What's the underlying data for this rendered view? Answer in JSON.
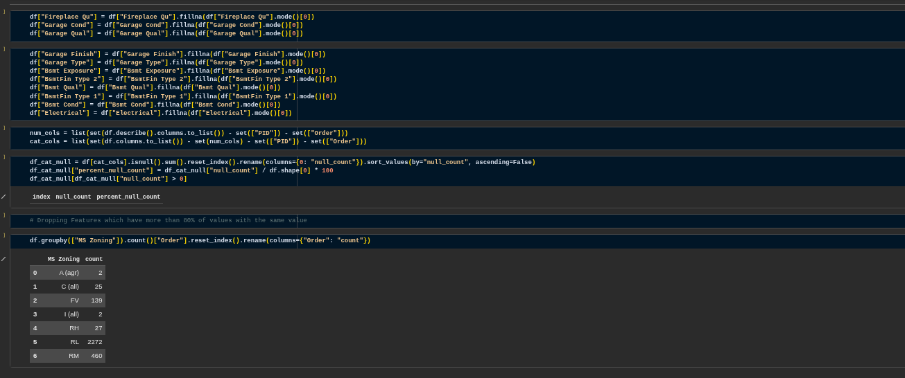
{
  "cells": [
    {
      "kind": "code",
      "prompt": "]",
      "lines": [
        "df[\"Fireplace Qu\"] = df[\"Fireplace Qu\"].fillna(df[\"Fireplace Qu\"].mode()[0])",
        "df[\"Garage Cond\"] = df[\"Garage Cond\"].fillna(df[\"Garage Cond\"].mode()[0])",
        "df[\"Garage Qual\"] = df[\"Garage Qual\"].fillna(df[\"Garage Qual\"].mode()[0])"
      ]
    },
    {
      "kind": "code",
      "prompt": "]",
      "lines": [
        "df[\"Garage Finish\"] = df[\"Garage Finish\"].fillna(df[\"Garage Finish\"].mode()[0])",
        "df[\"Garage Type\"] = df[\"Garage Type\"].fillna(df[\"Garage Type\"].mode()[0])",
        "df[\"Bsmt Exposure\"] = df[\"Bsmt Exposure\"].fillna(df[\"Bsmt Exposure\"].mode()[0])",
        "df[\"BsmtFin Type 2\"] = df[\"BsmtFin Type 2\"].fillna(df[\"BsmtFin Type 2\"].mode()[0])",
        "df[\"Bsmt Qual\"] = df[\"Bsmt Qual\"].fillna(df[\"Bsmt Qual\"].mode()[0])",
        "df[\"BsmtFin Type 1\"] = df[\"BsmtFin Type 1\"].fillna(df[\"BsmtFin Type 1\"].mode()[0])",
        "df[\"Bsmt Cond\"] = df[\"Bsmt Cond\"].fillna(df[\"Bsmt Cond\"].mode()[0])",
        "df[\"Electrical\"] = df[\"Electrical\"].fillna(df[\"Electrical\"].mode()[0])"
      ]
    },
    {
      "kind": "code",
      "prompt": "]",
      "lines": [
        "num_cols = list(set(df.describe().columns.to_list()) - set([\"PID\"]) - set([\"Order\"]))",
        "cat_cols = list(set(df.columns.to_list()) - set(num_cols) - set([\"PID\"]) - set([\"Order\"]))"
      ]
    },
    {
      "kind": "code",
      "prompt": "]",
      "lines": [
        "df_cat_null = df[cat_cols].isnull().sum().reset_index().rename(columns={0: \"null_count\"}).sort_values(by=\"null_count\", ascending=False)",
        "df_cat_null[\"percent_null_count\"] = df_cat_null[\"null_count\"] / df.shape[0] * 100",
        "df_cat_null[df_cat_null[\"null_count\"] > 0]"
      ],
      "output": {
        "columns": [
          "index",
          "null_count",
          "percent_null_count"
        ]
      }
    },
    {
      "kind": "comment",
      "prompt": "]",
      "lines": [
        "# Dropping Features which have more than 80% of values with the same value"
      ]
    },
    {
      "kind": "code",
      "prompt": "]",
      "lines": [
        "df.groupby([\"MS Zoning\"]).count()[\"Order\"].reset_index().rename(columns={\"Order\": \"count\"})"
      ],
      "output": {
        "columns": [
          "",
          "MS Zoning",
          "count"
        ],
        "rows": [
          [
            "0",
            "A (agr)",
            "2"
          ],
          [
            "1",
            "C (all)",
            "25"
          ],
          [
            "2",
            "FV",
            "139"
          ],
          [
            "3",
            "I (all)",
            "2"
          ],
          [
            "4",
            "RH",
            "27"
          ],
          [
            "5",
            "RL",
            "2272"
          ],
          [
            "6",
            "RM",
            "460"
          ]
        ]
      }
    }
  ]
}
